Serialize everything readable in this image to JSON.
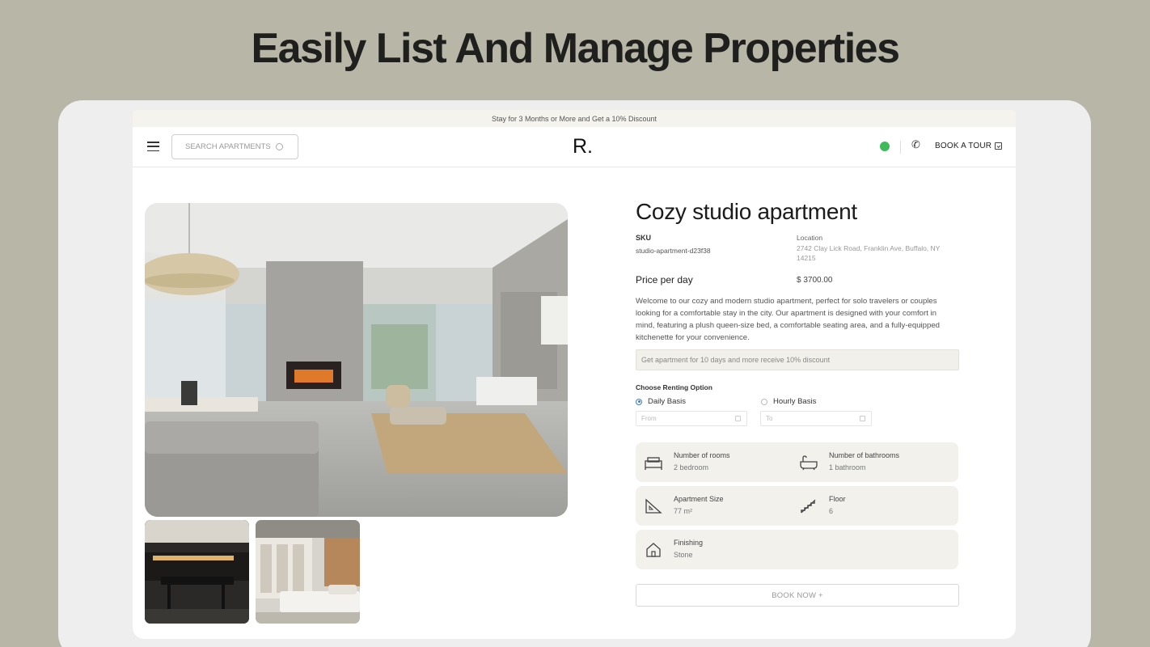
{
  "headline": "Easily List And Manage Properties",
  "banner": "Stay for 3 Months or More and Get a 10% Discount",
  "nav": {
    "search_placeholder": "SEARCH APARTMENTS",
    "logo": "R.",
    "book_tour": "BOOK A TOUR",
    "icons": [
      "menu-icon",
      "search-icon",
      "whatsapp-icon",
      "phone-icon",
      "calendar-icon"
    ]
  },
  "listing": {
    "title": "Cozy studio apartment",
    "sku_label": "SKU",
    "sku": "studio-apartment-d23f38",
    "location_label": "Location",
    "location": "2742 Clay Lick Road, Franklin Ave, Buffalo, NY 14215",
    "price_label": "Price per day",
    "price": "$ 3700.00",
    "description": "Welcome to our cozy and modern studio apartment, perfect for solo travelers or couples looking for a comfortable stay in the city. Our apartment is designed with your comfort in mind, featuring a plush queen-size bed, a comfortable seating area, and a fully-equipped kitchenette for your convenience.",
    "promo": "Get apartment for 10 days and more receive 10% discount",
    "renting": {
      "label": "Choose Renting Option",
      "options": [
        "Daily Basis",
        "Hourly Basis"
      ],
      "selected": "Daily Basis",
      "from_placeholder": "From",
      "to_placeholder": "To"
    },
    "features": [
      {
        "title": "Number of rooms",
        "value": "2 bedroom",
        "icon": "bed-icon"
      },
      {
        "title": "Number of bathrooms",
        "value": "1 bathroom",
        "icon": "bathtub-icon"
      },
      {
        "title": "Apartment Size",
        "value": "77 m²",
        "icon": "ruler-icon"
      },
      {
        "title": "Floor",
        "value": "6",
        "icon": "stairs-icon"
      },
      {
        "title": "Finishing",
        "value": "Stone",
        "icon": "house-icon"
      }
    ],
    "book_now": "BOOK NOW +"
  },
  "colors": {
    "page_bg": "#b8b6a6",
    "frame_bg": "#eeeeee",
    "feature_bg": "#f2f1ec",
    "accent_whatsapp": "#3dbb5a",
    "radio_selected": "#3a7be0"
  }
}
